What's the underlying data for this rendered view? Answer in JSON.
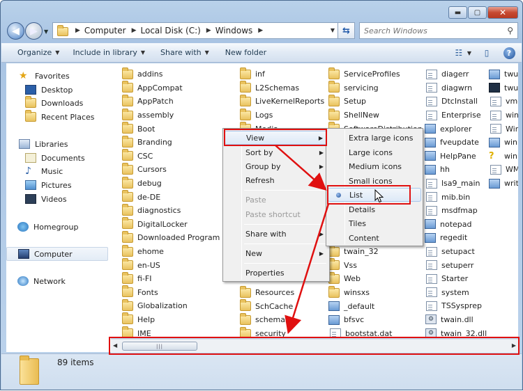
{
  "window": {
    "caption": {
      "minimize": "▬",
      "maximize": "▢",
      "close": "✕"
    }
  },
  "address_bar": {
    "crumbs": [
      "Computer",
      "Local Disk (C:)",
      "Windows"
    ]
  },
  "search": {
    "placeholder": "Search Windows"
  },
  "toolbar": {
    "organize": "Organize",
    "include_in_library": "Include in library",
    "share_with": "Share with",
    "new_folder": "New folder"
  },
  "nav_pane": {
    "favorites": "Favorites",
    "desktop": "Desktop",
    "downloads": "Downloads",
    "recent_places": "Recent Places",
    "libraries": "Libraries",
    "documents": "Documents",
    "music": "Music",
    "pictures": "Pictures",
    "videos": "Videos",
    "homegroup": "Homegroup",
    "computer": "Computer",
    "network": "Network"
  },
  "files": {
    "col1": [
      "addins",
      "AppCompat",
      "AppPatch",
      "assembly",
      "Boot",
      "Branding",
      "CSC",
      "Cursors",
      "debug",
      "de-DE",
      "diagnostics",
      "DigitalLocker",
      "Downloaded Program Files",
      "ehome",
      "en-US",
      "fi-FI",
      "Fonts",
      "Globalization",
      "Help",
      "IME"
    ],
    "col2": [
      "inf",
      "L2Schemas",
      "LiveKernelReports",
      "Logs",
      "Media"
    ],
    "col2b": [
      "Vss",
      "Web",
      "winsxs",
      "_default",
      "bfsvc",
      "bootstat.dat"
    ],
    "col2c": [
      "Resources",
      "SchCache",
      "schemas",
      "security"
    ],
    "col3": [
      "ServiceProfiles",
      "servicing",
      "Setup",
      "ShellNew",
      "SoftwareDistribution"
    ],
    "col3b": [
      "twain_32",
      "Vss",
      "Web",
      "winsxs",
      "_default",
      "bfsvc",
      "bootstat.dat"
    ],
    "col4": [
      "diagerr",
      "diagwrn",
      "DtcInstall",
      "Enterprise",
      "explorer",
      "fveupdate",
      "HelpPane",
      "hh",
      "lsa9_main",
      "mib.bin",
      "msdfmap",
      "notepad",
      "regedit",
      "setupact",
      "setuperr",
      "Starter",
      "system",
      "TSSysprep",
      "twain.dll",
      "twain_32.dll"
    ],
    "col5": [
      "twun",
      "twun",
      "vmgc",
      "win",
      "Wind",
      "winh",
      "winh",
      "WMS",
      "write"
    ]
  },
  "context_menu": {
    "view": "View",
    "sort_by": "Sort by",
    "group_by": "Group by",
    "refresh": "Refresh",
    "paste": "Paste",
    "paste_shortcut": "Paste shortcut",
    "share_with": "Share with",
    "new": "New",
    "properties": "Properties"
  },
  "view_submenu": {
    "extra_large_icons": "Extra large icons",
    "large_icons": "Large icons",
    "medium_icons": "Medium icons",
    "small_icons": "Small icons",
    "list": "List",
    "details": "Details",
    "tiles": "Tiles",
    "content": "Content"
  },
  "status_bar": {
    "item_count": "89 items"
  },
  "colors": {
    "annotation_red": "#e01010",
    "selection_blue": "#dde9f7"
  }
}
